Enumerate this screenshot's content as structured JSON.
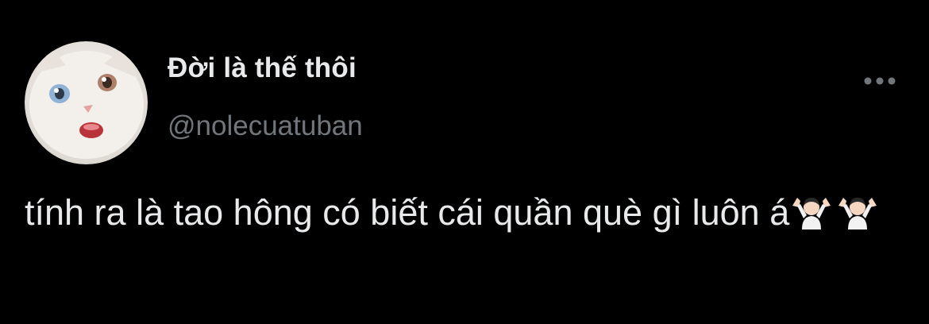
{
  "tweet": {
    "author": {
      "display_name": "Đời là thế thôi",
      "handle": "@nolecuatuban",
      "avatar": "white-kitten-icon"
    },
    "more_icon": "more-options-icon",
    "text": "tính ra là tao hông có biết cái quần què gì luôn á",
    "emojis": [
      "person-shrugging-emoji",
      "person-shrugging-emoji"
    ]
  },
  "colors": {
    "background": "#000000",
    "primary_text": "#e7e9ea",
    "secondary_text": "#71767b"
  }
}
